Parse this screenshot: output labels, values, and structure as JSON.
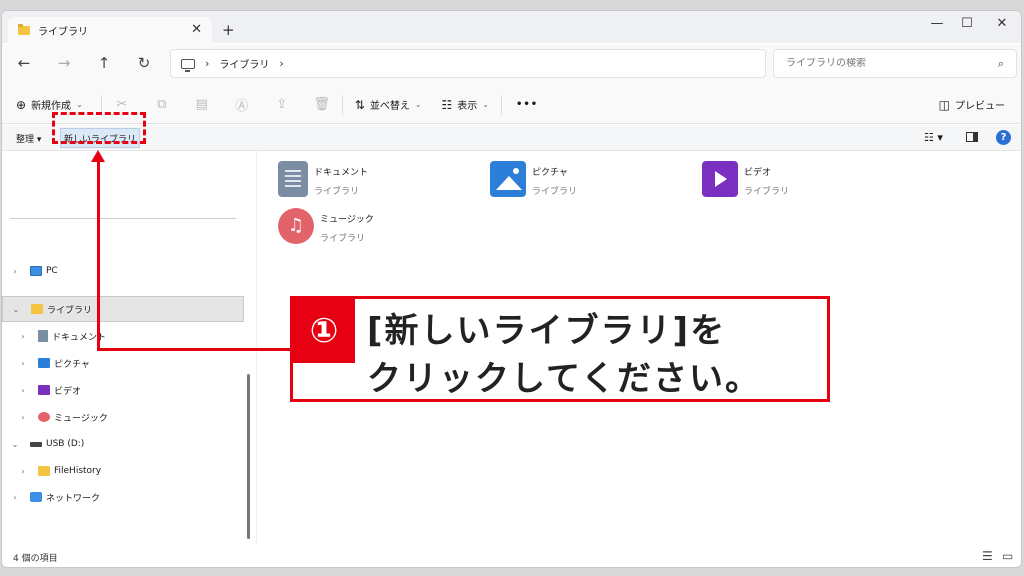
{
  "tab": {
    "title": "ライブラリ",
    "close": "✕",
    "new_tab": "+"
  },
  "window_controls": {
    "minimize": "—",
    "maximize": "☐",
    "close": "✕"
  },
  "nav": {
    "back": "←",
    "forward": "→",
    "up": "↑",
    "refresh": "↻"
  },
  "address": {
    "crumbs": [
      "ライブラリ"
    ],
    "separator": "›"
  },
  "search": {
    "placeholder": "ライブラリの検索"
  },
  "commandbar": {
    "new": "新規作成",
    "sort": "並べ替え",
    "view": "表示",
    "more": "•••",
    "preview": "プレビュー"
  },
  "library_toolbar": {
    "organize": "整理",
    "new_library": "新しいライブラリ"
  },
  "tree": [
    {
      "label": "PC"
    },
    {
      "label": "ライブラリ"
    },
    {
      "label": "ドキュメント"
    },
    {
      "label": "ピクチャ"
    },
    {
      "label": "ビデオ"
    },
    {
      "label": "ミュージック"
    },
    {
      "label": "USB (D:)"
    },
    {
      "label": "FileHistory"
    },
    {
      "label": "ネットワーク"
    }
  ],
  "libraries": [
    {
      "name": "ドキュメント",
      "type": "ライブラリ",
      "icon": "document-library-icon"
    },
    {
      "name": "ピクチャ",
      "type": "ライブラリ",
      "icon": "pictures-library-icon"
    },
    {
      "name": "ビデオ",
      "type": "ライブラリ",
      "icon": "videos-library-icon"
    },
    {
      "name": "ミュージック",
      "type": "ライブラリ",
      "icon": "music-library-icon"
    }
  ],
  "status": {
    "count": "4 個の項目"
  },
  "annotation": {
    "step": "①",
    "line1": "[新しいライブラリ]を",
    "line2": "クリックしてください。"
  },
  "colors": {
    "accent_red": "#e60012",
    "selected_bg": "#e5e5e5",
    "new_library_bg": "#dbe8f6"
  }
}
